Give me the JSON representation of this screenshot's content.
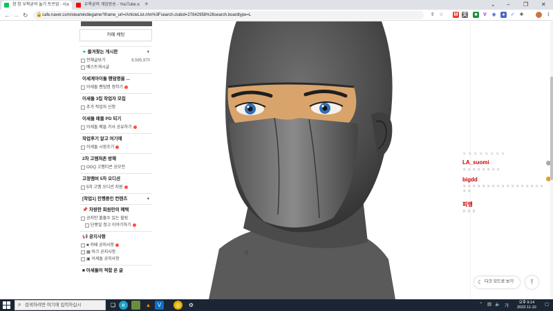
{
  "browser": {
    "tabs": [
      {
        "title": "창 창 우왁굳의 놀기 트르업 : 시",
        "active": true,
        "favicon_color": "#03c75a"
      },
      {
        "title": "우왁굳의 게임방송 - YouTube",
        "active": false,
        "favicon_color": "#ff0000"
      }
    ],
    "url": "cafe.naver.com/steamindiegame?iframe_url=/ArticleList.nhn%3Fsearch.clubid=27842958%26search.boardtype=L"
  },
  "sidebar": {
    "chat_button": "카페 채팅",
    "favorites_title": "즐겨찾는 게시판",
    "favorites": [
      {
        "label": "전체글보기",
        "count": "8,565,970"
      },
      {
        "label": "베스트게시글"
      }
    ],
    "sections": [
      {
        "title": "이세계아이돌 팬덤명을 ...",
        "items": [
          {
            "label": "이세돌 팬덤명 정하기",
            "new": true
          }
        ]
      },
      {
        "title": "이세돌 3집 작업자 모집",
        "items": [
          {
            "label": "추가 작업자 신청"
          }
        ]
      },
      {
        "title": "이세돌 메들 PD 되기",
        "items": [
          {
            "label": "이세돌 메들 가사 공유하기",
            "new": true
          }
        ]
      },
      {
        "title": "작업후기 알고 여기에",
        "items": [
          {
            "label": "이세돌 시장조기",
            "new": true
          }
        ]
      },
      {
        "title": "2차 고멤쳐존 방해",
        "items": [
          {
            "label": "OGQ 고멤티콘 공모전"
          }
        ]
      },
      {
        "title": "고정멤버 5차 오디션",
        "items": [
          {
            "label": "5차 고멤 오디션 지원",
            "new": true
          }
        ]
      }
    ],
    "group_header": "[작업1] 진행중인 컨텐츠",
    "notice_members_title": "차량한 회원만의 혜택",
    "notice_members_items": [
      {
        "label": "공지만 볼줄수 있는 힐링",
        "sub": false
      },
      {
        "label": "단풍잎 정고 이야기하기",
        "sub": true,
        "new": true
      }
    ],
    "notices_title": "공지사항",
    "notices": [
      {
        "label": "■ 카페 공지사항",
        "new": true
      },
      {
        "label": "▦ 마크 공지사항"
      },
      {
        "label": "▣ 이세돌 공지사항"
      }
    ],
    "bottom_title": "■ 아세돌어 적합 온 글"
  },
  "chat": {
    "entries": [
      {
        "name": "LA_suomi",
        "message": "ㅋ ㅋ ㅋ ㅋ ㅋ ㅋ ㅋ ㅋ"
      },
      {
        "name": "bigdd",
        "message": "ㅋ ㅋ ㅋ ㅋ ㅋ ㅋ ㅋ ㅋ ㅋ ㅋ ㅋ ㅋ ㅋ ㅋ ㅋ ㅋ ㅋ ㅋ ㅋ"
      },
      {
        "name": "피엥",
        "message": "ㅁ ㅁ ㅁ"
      }
    ],
    "header_dots": "ㅋ ㅋ ㅋ ㅋ ㅋ ㅋ ㅋ ㅋ",
    "dark_mode_label": "다크 모드로 보기",
    "name_color": "#c80000"
  },
  "taskbar": {
    "search_placeholder": "검색하려면 여기에 입력하십시",
    "time": "오후 9:14",
    "date": "2022-11-10"
  }
}
